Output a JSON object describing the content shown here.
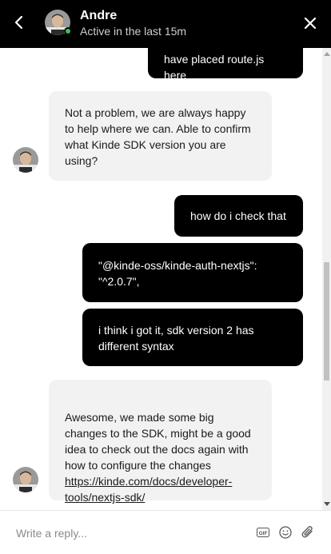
{
  "header": {
    "agent_name": "Andre",
    "agent_status": "Active in the last 15m",
    "back_icon": "chevron-left-icon",
    "close_icon": "close-icon",
    "background": "#000000",
    "online_color": "#3ec15a"
  },
  "messages": [
    {
      "sender": "user",
      "text": "have placed route.js here"
    },
    {
      "sender": "agent",
      "text": "Not a problem, we are always happy to help where we can. Able to confirm what Kinde SDK version you are using?"
    },
    {
      "sender": "user",
      "text": "how do i check that"
    },
    {
      "sender": "user",
      "text": "\"@kinde-oss/kinde-auth-nextjs\": \"^2.0.7\","
    },
    {
      "sender": "user",
      "text": "i think i got it, sdk version 2 has different syntax"
    },
    {
      "sender": "agent",
      "text": "Awesome, we made some big changes to the SDK, might be a good idea to check out the docs again with how to configure the changes",
      "link": "https://kinde.com/docs/developer-tools/nextjs-sdk/"
    }
  ],
  "composer": {
    "placeholder": "Write a reply...",
    "gif_label": "GIF",
    "icons": [
      "gif-icon",
      "emoji-icon",
      "paperclip-icon"
    ]
  },
  "colors": {
    "user_bubble": "#000000",
    "agent_bubble": "#f2f2f2"
  }
}
